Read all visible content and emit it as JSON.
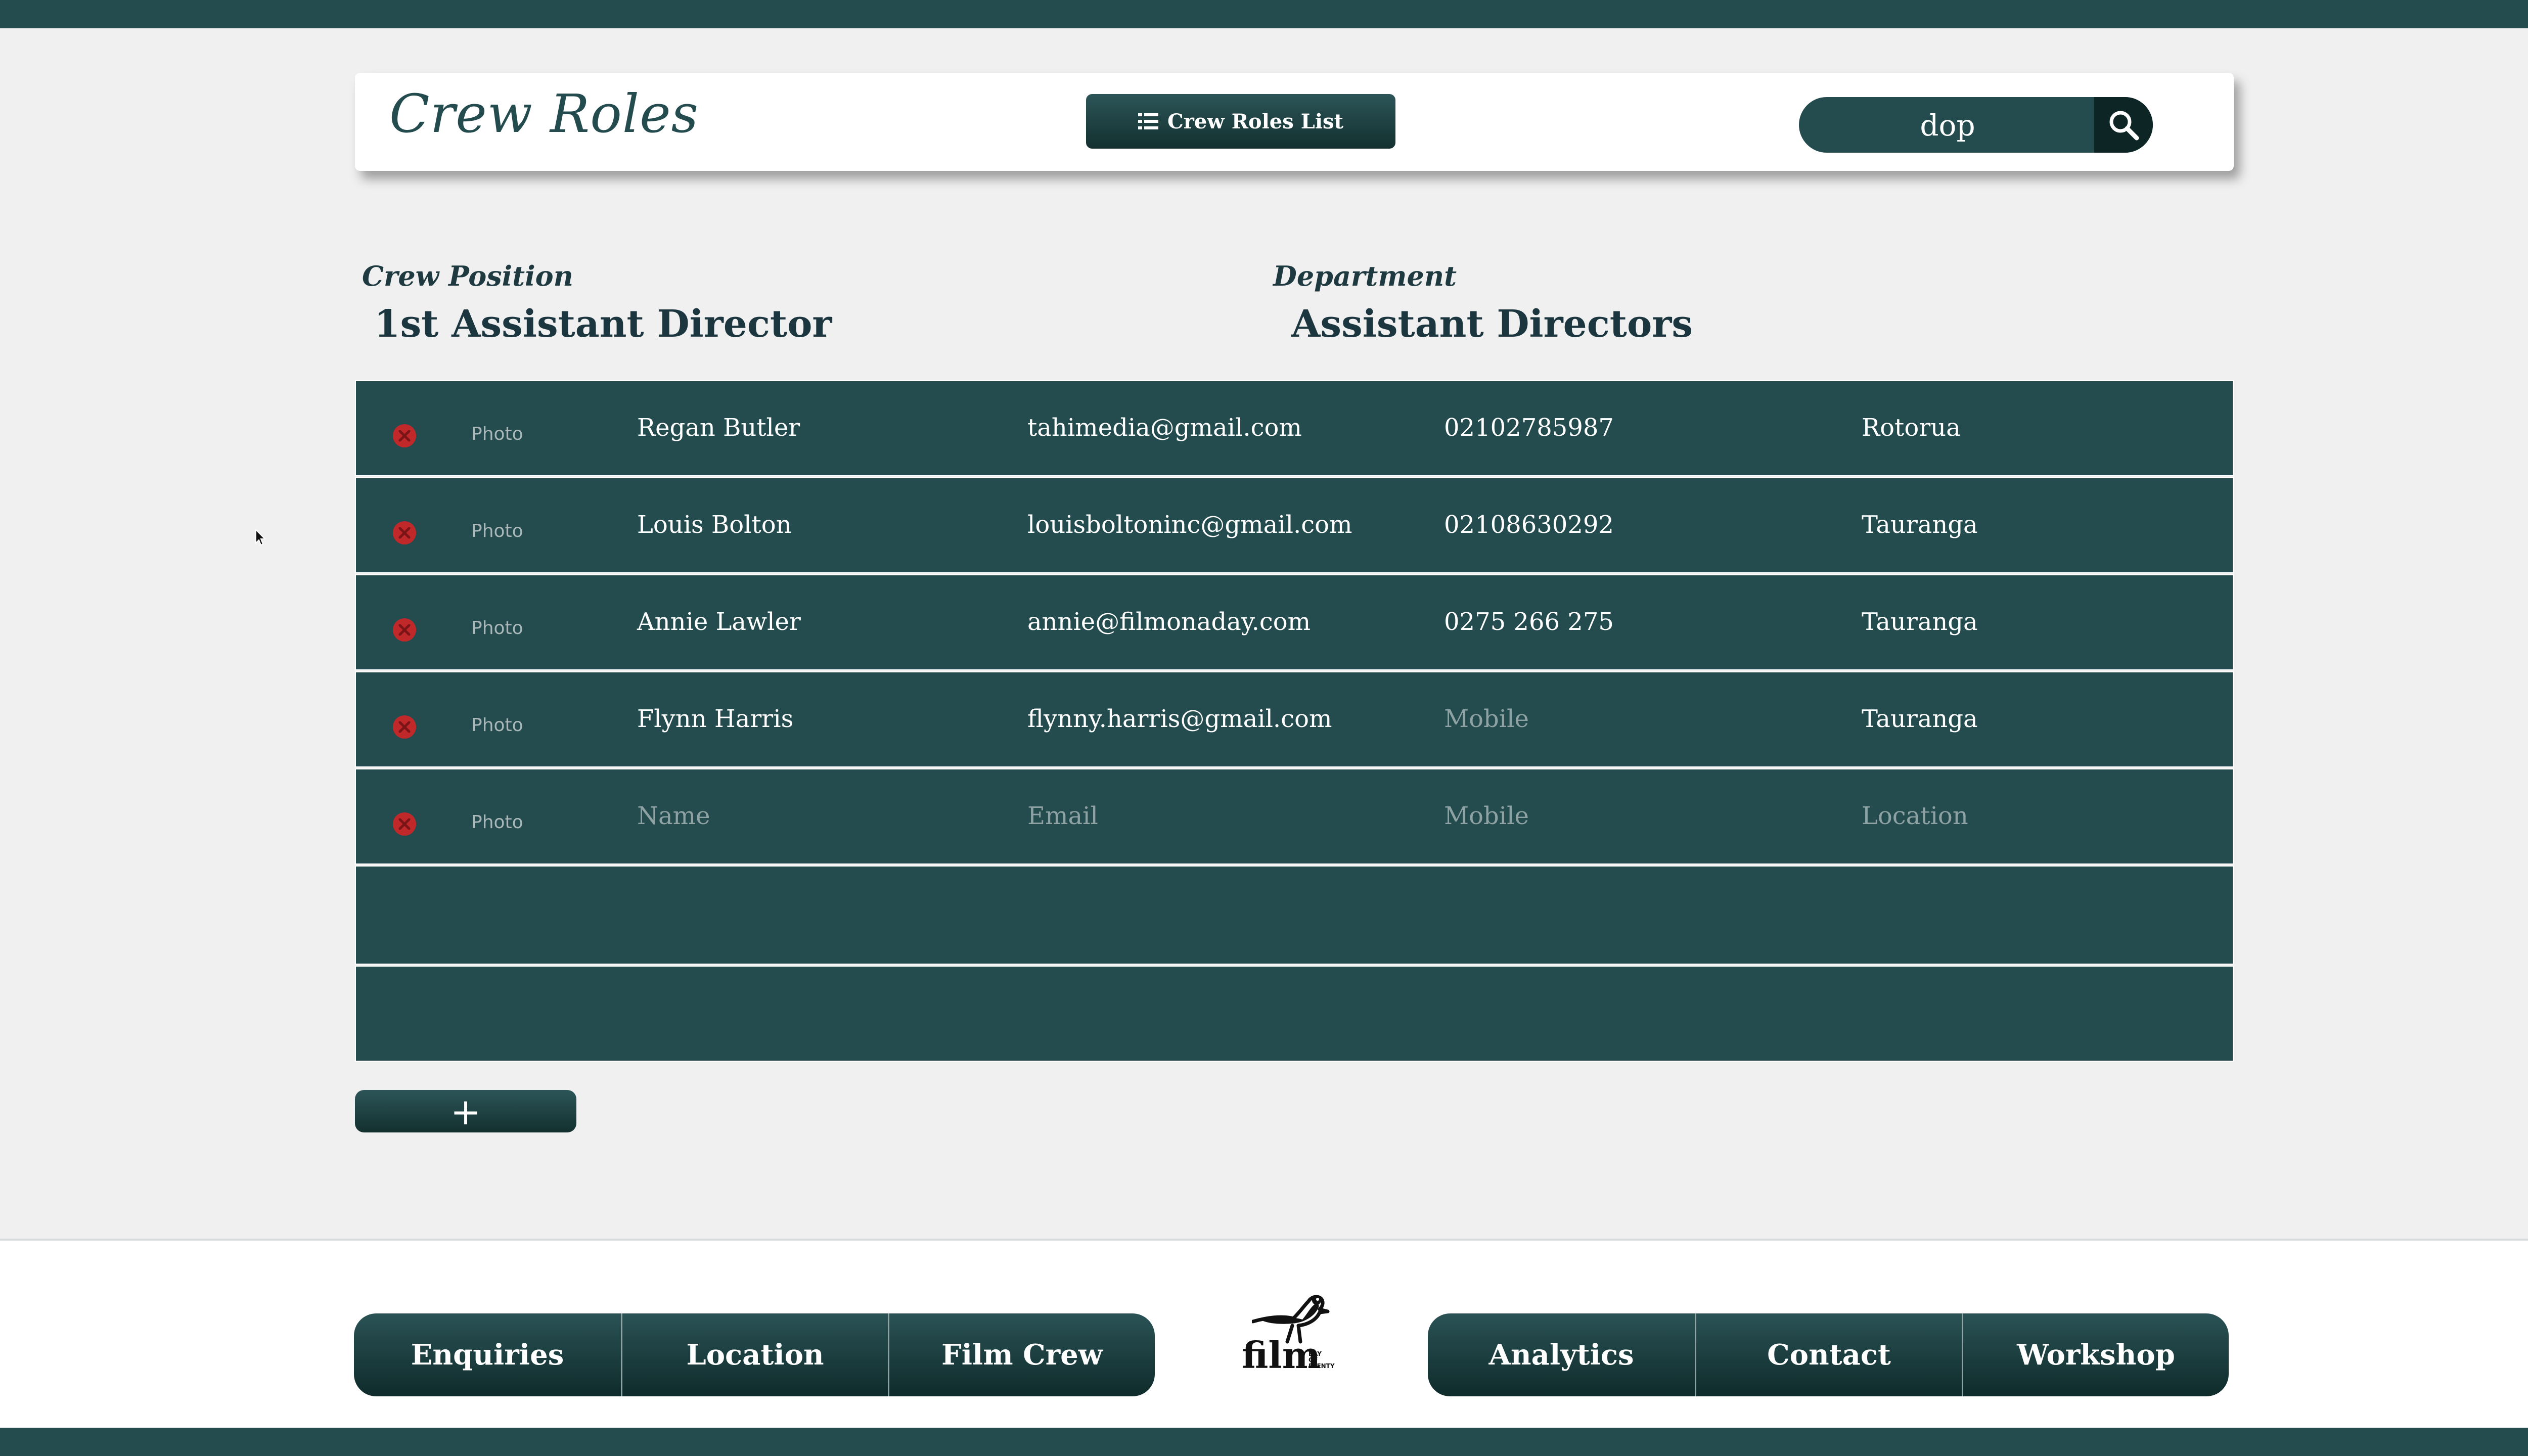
{
  "header": {
    "title": "Crew Roles",
    "list_button_label": "Crew Roles List",
    "search_value": "dop"
  },
  "position": {
    "label": "Crew Position",
    "value": "1st Assistant Director"
  },
  "department": {
    "label": "Department",
    "value": "Assistant Directors"
  },
  "table": {
    "photo_label": "Photo",
    "rows": [
      {
        "name": "Regan Butler",
        "email": "tahimedia@gmail.com",
        "mobile": "02102785987",
        "location": "Rotorua"
      },
      {
        "name": "Louis Bolton",
        "email": "louisboltoninc@gmail.com",
        "mobile": "02108630292",
        "location": "Tauranga"
      },
      {
        "name": "Annie Lawler",
        "email": "annie@filmonaday.com",
        "mobile": "0275 266 275",
        "location": "Tauranga"
      },
      {
        "name": "Flynn Harris",
        "email": "flynny.harris@gmail.com",
        "mobile": "",
        "location": "Tauranga"
      },
      {
        "name": "",
        "email": "",
        "mobile": "",
        "location": ""
      }
    ],
    "placeholders": {
      "name": "Name",
      "email": "Email",
      "mobile": "Mobile",
      "location": "Location"
    }
  },
  "add_button_label": "+",
  "footer": {
    "nav_left": [
      "Enquiries",
      "Location",
      "Film Crew"
    ],
    "nav_right": [
      "Analytics",
      "Contact",
      "Workshop"
    ],
    "logo_text": "film",
    "logo_small": [
      "BAY",
      "OF",
      "PLENTY"
    ]
  },
  "colors": {
    "primary": "#244b4e",
    "dark": "#0d2625",
    "delete": "#c0282a",
    "background": "#f0f0f0"
  }
}
